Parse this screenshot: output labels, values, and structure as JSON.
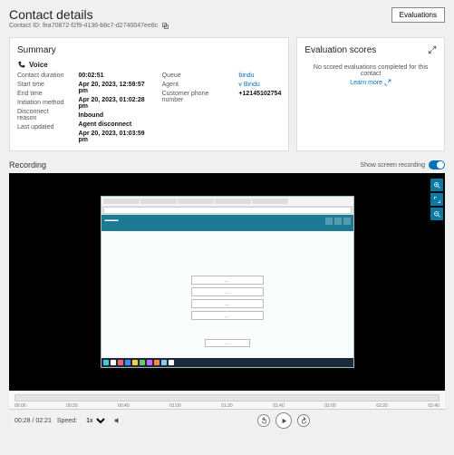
{
  "header": {
    "title": "Contact details",
    "contact_id_label": "Contact ID: fea70872-f2f9-4136-b8c7-d2740047ee8c",
    "evaluations_btn": "Evaluations"
  },
  "summary": {
    "title": "Summary",
    "voice": "Voice",
    "fields_left": [
      {
        "label": "Contact duration",
        "value": "00:02:51"
      },
      {
        "label": "Start time",
        "value": "Apr 20, 2023, 12:59:57 pm"
      },
      {
        "label": "End time",
        "value": "Apr 20, 2023, 01:02:28 pm"
      },
      {
        "label": "Initiation method",
        "value": "Inbound"
      },
      {
        "label": "Disconnect reason",
        "value": "Agent disconnect"
      },
      {
        "label": "Last updated",
        "value": "Apr 20, 2023, 01:03:59 pm"
      }
    ],
    "fields_mid": [
      {
        "label": "Queue",
        "value": "bindu"
      },
      {
        "label": "Agent",
        "value": "v Bindu"
      },
      {
        "label": "Customer phone number",
        "value": "+12145102754"
      }
    ]
  },
  "eval": {
    "title": "Evaluation scores",
    "empty": "No scored evaluations completed for this contact",
    "learn_more": "Learn more"
  },
  "recording": {
    "title": "Recording",
    "toggle_label": "Show screen recording"
  },
  "timeline": {
    "ticks": [
      "00:00",
      "00:20",
      "00:40",
      "01:00",
      "01:20",
      "01:40",
      "02:00",
      "02:20",
      "02:40"
    ]
  },
  "controls": {
    "time": "00:28 / 02:21",
    "speed_label": "Speed:",
    "speed_value": "1x"
  }
}
